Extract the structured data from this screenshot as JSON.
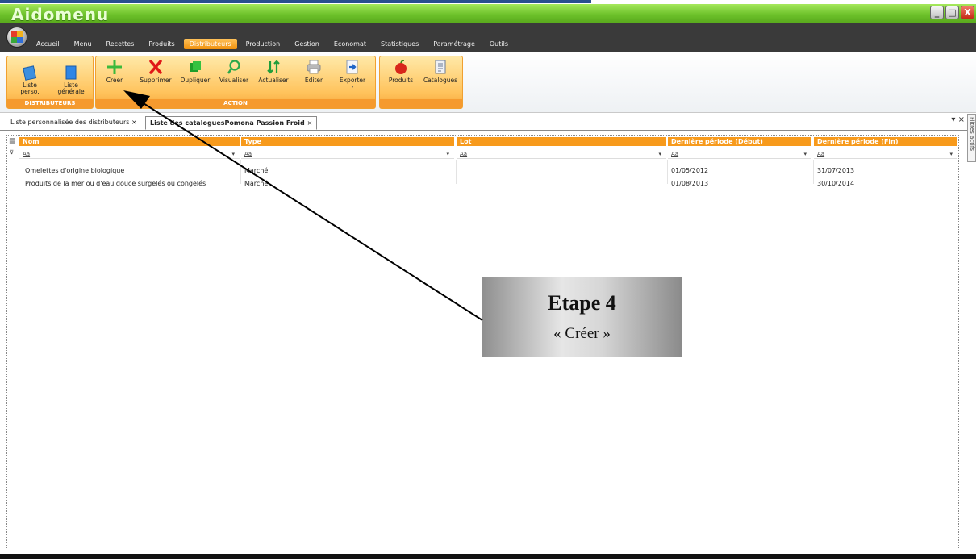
{
  "app": {
    "title": "Aidomenu",
    "window_buttons": {
      "minimize": "_",
      "maximize": "□",
      "close": "X"
    }
  },
  "menu": {
    "items": [
      "Accueil",
      "Menu",
      "Recettes",
      "Produits",
      "Distributeurs",
      "Production",
      "Gestion",
      "Economat",
      "Statistiques",
      "Paramétrage",
      "Outils"
    ],
    "active": "Distributeurs"
  },
  "ribbon": {
    "groups": [
      {
        "label": "DISTRIBUTEURS",
        "buttons": [
          {
            "label": "Liste\nperso.",
            "icon": "book-icon"
          },
          {
            "label": "Liste\ngénérale",
            "icon": "book-icon"
          }
        ]
      },
      {
        "label": "ACTION",
        "buttons": [
          {
            "label": "Créer",
            "icon": "plus-icon"
          },
          {
            "label": "Supprimer",
            "icon": "x-icon"
          },
          {
            "label": "Dupliquer",
            "icon": "duplicate-icon"
          },
          {
            "label": "Visualiser",
            "icon": "magnifier-icon"
          },
          {
            "label": "Actualiser",
            "icon": "refresh-arrows-icon"
          },
          {
            "label": "Editer",
            "icon": "printer-icon"
          },
          {
            "label": "Exporter",
            "icon": "export-icon"
          }
        ]
      },
      {
        "label": "",
        "buttons": [
          {
            "label": "Produits",
            "icon": "apple-icon"
          },
          {
            "label": "Catalogues",
            "icon": "catalog-icon"
          }
        ]
      }
    ]
  },
  "tabs": {
    "items": [
      {
        "label": "Liste personnalisée des distributeurs",
        "close": "×"
      },
      {
        "label": "Liste des cataloguesPomona Passion Froid",
        "close": "×"
      }
    ],
    "right_controls": "▾ ×",
    "side_panel": "Filtres actifs"
  },
  "grid": {
    "columns": [
      "Nom",
      "Type",
      "Lot",
      "Dernière période (Début)",
      "Dernière période (Fin)"
    ],
    "filter_placeholder": "Aa",
    "rows": [
      [
        "Omelettes d'origine biologique",
        "Marché",
        "",
        "01/05/2012",
        "31/07/2013"
      ],
      [
        "Produits de la mer ou d'eau douce surgelés ou congelés",
        "Marché",
        "",
        "01/08/2013",
        "30/10/2014"
      ]
    ]
  },
  "callout": {
    "title": "Etape 4",
    "subtitle": "« Créer »"
  },
  "colors": {
    "titlebar_green": "#6cc12a",
    "accent_orange": "#f79a1c",
    "menubar": "#3a3a3a"
  }
}
